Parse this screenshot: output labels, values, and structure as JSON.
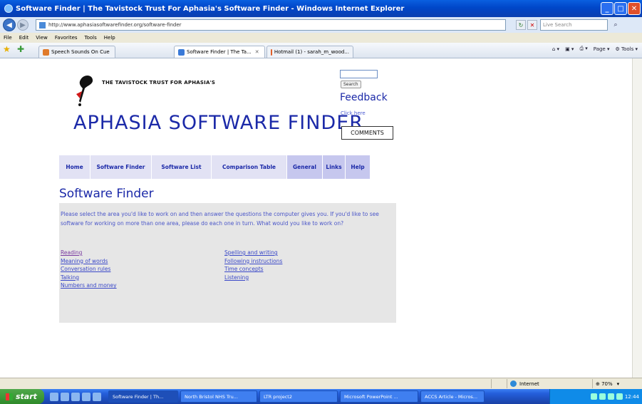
{
  "window": {
    "title": "Software Finder | The Tavistock Trust For Aphasia's Software Finder - Windows Internet Explorer",
    "buttons": {
      "minimize": "_",
      "maximize": "□",
      "close": "✕"
    }
  },
  "address_bar": {
    "url": "http://www.aphasiasoftwarefinder.org/software-finder",
    "search_placeholder": "Live Search"
  },
  "menu": [
    "File",
    "Edit",
    "View",
    "Favorites",
    "Tools",
    "Help"
  ],
  "tabs": [
    {
      "label": "Speech Sounds On Cue",
      "active": false,
      "color": "#e07a2a"
    },
    {
      "label": "Software Finder | The Ta...",
      "active": true,
      "color": "#3a7ad8"
    },
    {
      "label": "Hotmail (1) - sarah_m_wood...",
      "active": false,
      "color": "#e0602a"
    }
  ],
  "toolbar_right": {
    "page": "Page",
    "tools": "Tools"
  },
  "page": {
    "trust_line": "THE TAVISTOCK TRUST FOR APHASIA'S",
    "site_title": "APHASIA SOFTWARE FINDER",
    "search_button": "Search",
    "feedback": "Feedback",
    "click_here": "Click here",
    "comments_button": "COMMENTS",
    "nav": [
      {
        "label": "Home"
      },
      {
        "label": "Software Finder"
      },
      {
        "label": "Software List"
      },
      {
        "label": "Comparison Table"
      },
      {
        "label": "General"
      },
      {
        "label": "Links"
      },
      {
        "label": "Help"
      }
    ],
    "heading": "Software Finder",
    "intro": "Please select the area you'd like to work on and then answer the questions the computer gives you. If you'd like to see software for working on more than one area, please do each one in turn. What would you like to work on?",
    "links_left": [
      "Reading",
      "Meaning of words",
      "Conversation rules",
      "Talking",
      "Numbers and money"
    ],
    "links_right": [
      "Spelling and writing",
      "Following instructions",
      "Time concepts",
      "Listening"
    ]
  },
  "status_bar": {
    "zone": "Internet",
    "zoom": "70%"
  },
  "taskbar": {
    "start": "start",
    "items": [
      "Software Finder | Th...",
      "North Bristol NHS Tru...",
      "LTR project2",
      "Microsoft PowerPoint ...",
      "ACCS Article - Micros..."
    ],
    "clock": "12:44"
  },
  "colors": {
    "brand_blue": "#1b29a8",
    "nav_bg": "#e2e2f4",
    "nav_alt": "#c6c7ee",
    "panel_bg": "#e6e6e6"
  }
}
